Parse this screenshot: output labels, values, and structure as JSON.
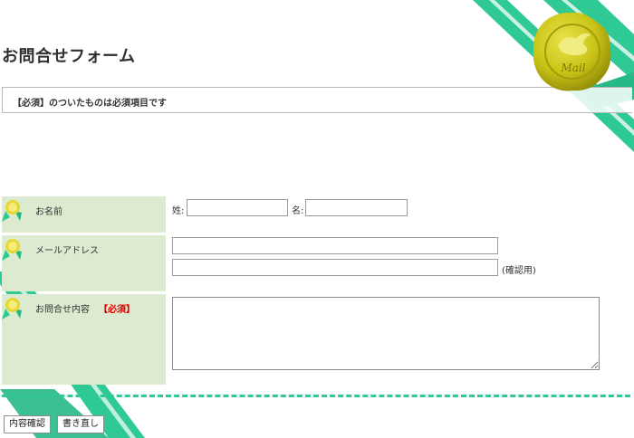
{
  "page": {
    "title": "お問合せフォーム"
  },
  "notice": {
    "text": "【必須】のついたものは必須項目です"
  },
  "seal": {
    "text": "Mail"
  },
  "form": {
    "name_row": {
      "label": "お名前",
      "last_name_label": "姓:",
      "last_name_value": "",
      "first_name_label": "名:",
      "first_name_value": ""
    },
    "email_row": {
      "label": "メールアドレス",
      "email_value": "",
      "confirm_value": "",
      "confirm_note": "(確認用)"
    },
    "inquiry_row": {
      "label": "お問合せ内容",
      "required_label": "【必須】",
      "content_value": ""
    }
  },
  "buttons": {
    "confirm_label": "内容確認",
    "reset_label": "書き直し"
  },
  "colors": {
    "ribbon": "#2ec995",
    "label_bg": "#dcebd0",
    "seal": "#c9c316",
    "required": "#e00000"
  }
}
